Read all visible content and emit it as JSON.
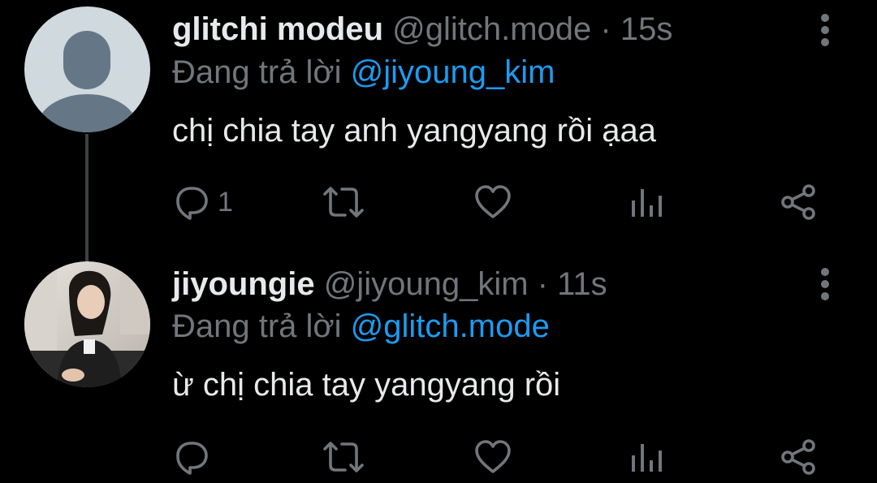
{
  "colors": {
    "background": "#000000",
    "text_primary": "#e7e9ea",
    "text_secondary": "#71767b",
    "link_blue": "#1d9bf0",
    "thread_line": "#3e4144"
  },
  "tweets": [
    {
      "display_name": "glitchi modeu",
      "handle": "@glitch.mode",
      "separator": "·",
      "time": "15s",
      "replying_prefix": "Đang trả lời ",
      "replying_to": "@jiyoung_kim",
      "text": "chị chia tay anh yangyang rồi ạaa",
      "reply_count": "1",
      "avatar_icon": "default-avatar-icon"
    },
    {
      "display_name": "jiyoungie",
      "handle": "@jiyoung_kim",
      "separator": "·",
      "time": "11s",
      "replying_prefix": "Đang trả lời ",
      "replying_to": "@glitch.mode",
      "text": "ừ chị chia tay yangyang rồi",
      "reply_count": "",
      "avatar_icon": "profile-photo-avatar"
    }
  ],
  "action_icons": [
    "reply-icon",
    "retweet-icon",
    "like-icon",
    "analytics-icon",
    "share-icon"
  ]
}
